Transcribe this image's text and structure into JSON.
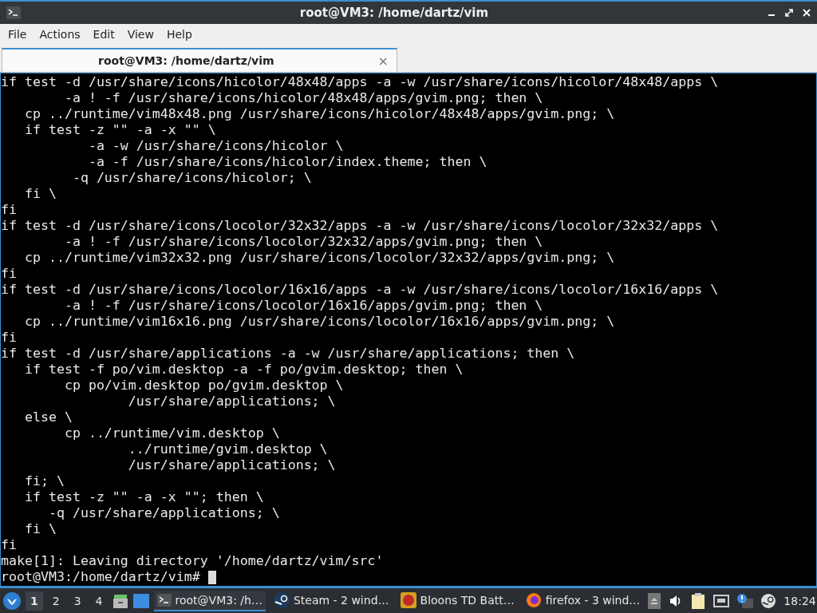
{
  "window": {
    "title": "root@VM3: /home/dartz/vim"
  },
  "menu": [
    "File",
    "Actions",
    "Edit",
    "View",
    "Help"
  ],
  "tabs": [
    {
      "label": "root@VM3: /home/dartz/vim",
      "selected": true,
      "close": "×"
    }
  ],
  "terminal": {
    "lines": [
      "if test -d /usr/share/icons/hicolor/48x48/apps -a -w /usr/share/icons/hicolor/48x48/apps \\",
      "        -a ! -f /usr/share/icons/hicolor/48x48/apps/gvim.png; then \\",
      "   cp ../runtime/vim48x48.png /usr/share/icons/hicolor/48x48/apps/gvim.png; \\",
      "   if test -z \"\" -a -x \"\" \\",
      "           -a -w /usr/share/icons/hicolor \\",
      "           -a -f /usr/share/icons/hicolor/index.theme; then \\",
      "         -q /usr/share/icons/hicolor; \\",
      "   fi \\",
      "fi",
      "if test -d /usr/share/icons/locolor/32x32/apps -a -w /usr/share/icons/locolor/32x32/apps \\",
      "        -a ! -f /usr/share/icons/locolor/32x32/apps/gvim.png; then \\",
      "   cp ../runtime/vim32x32.png /usr/share/icons/locolor/32x32/apps/gvim.png; \\",
      "fi",
      "if test -d /usr/share/icons/locolor/16x16/apps -a -w /usr/share/icons/locolor/16x16/apps \\",
      "        -a ! -f /usr/share/icons/locolor/16x16/apps/gvim.png; then \\",
      "   cp ../runtime/vim16x16.png /usr/share/icons/locolor/16x16/apps/gvim.png; \\",
      "fi",
      "if test -d /usr/share/applications -a -w /usr/share/applications; then \\",
      "   if test -f po/vim.desktop -a -f po/gvim.desktop; then \\",
      "        cp po/vim.desktop po/gvim.desktop \\",
      "                /usr/share/applications; \\",
      "   else \\",
      "        cp ../runtime/vim.desktop \\",
      "                ../runtime/gvim.desktop \\",
      "                /usr/share/applications; \\",
      "   fi; \\",
      "   if test -z \"\" -a -x \"\"; then \\",
      "      -q /usr/share/applications; \\",
      "   fi \\",
      "fi",
      "make[1]: Leaving directory '/home/dartz/vim/src'"
    ],
    "prompt": "root@VM3:/home/dartz/vim# "
  },
  "taskbar": {
    "workspaces": [
      {
        "label": "1",
        "selected": true
      },
      {
        "label": "2",
        "selected": false
      },
      {
        "label": "3",
        "selected": false
      },
      {
        "label": "4",
        "selected": false
      }
    ],
    "tasks": [
      {
        "kind": "terminal",
        "label": "root@VM3: /h…",
        "selected": true
      },
      {
        "kind": "steam",
        "label": "Steam - 2 wind…",
        "selected": false
      },
      {
        "kind": "game",
        "label": "Bloons TD Batt…",
        "selected": false
      },
      {
        "kind": "firefox",
        "label": "firefox - 3 wind…",
        "selected": false
      }
    ],
    "clock": "18:24"
  }
}
